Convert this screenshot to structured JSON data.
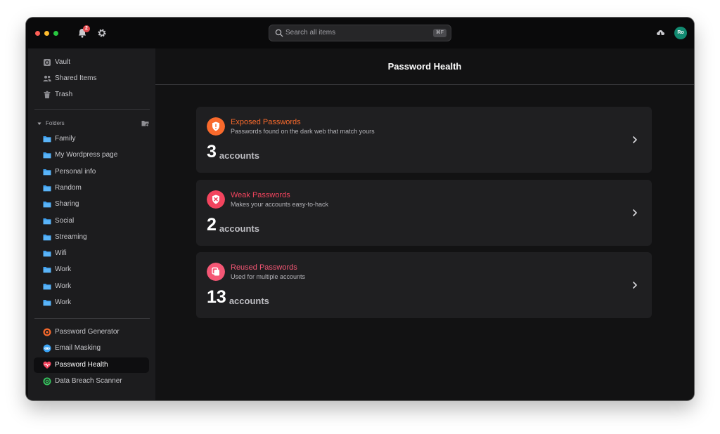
{
  "titlebar": {
    "notification_count": "2",
    "search": {
      "placeholder": "Search all items",
      "shortcut": "⌘F"
    },
    "avatar_initials": "Ro"
  },
  "sidebar": {
    "top_items": [
      {
        "label": "Vault",
        "icon": "vault-icon"
      },
      {
        "label": "Shared Items",
        "icon": "users-icon"
      },
      {
        "label": "Trash",
        "icon": "trash-icon"
      }
    ],
    "folders_label": "Folders",
    "folders": [
      "Family",
      "My Wordpress page",
      "Personal info",
      "Random",
      "Sharing",
      "Social",
      "Streaming",
      "Wifi",
      "Work",
      "Work",
      "Work"
    ],
    "tools": [
      {
        "label": "Password Generator",
        "icon": "password-generator-icon",
        "active": false
      },
      {
        "label": "Email Masking",
        "icon": "email-masking-icon",
        "active": false
      },
      {
        "label": "Password Health",
        "icon": "heart-pulse-icon",
        "active": true
      },
      {
        "label": "Data Breach Scanner",
        "icon": "breach-scanner-icon",
        "active": false
      }
    ]
  },
  "main": {
    "title": "Password Health",
    "cards": [
      {
        "title": "Exposed Passwords",
        "subtitle": "Passwords found on the dark web that match yours",
        "count": "3",
        "unit": "accounts",
        "color": "#f96a2c",
        "icon": "shield-alert-icon"
      },
      {
        "title": "Weak Passwords",
        "subtitle": "Makes your accounts easy-to-hack",
        "count": "2",
        "unit": "accounts",
        "color": "#f3445e",
        "icon": "shield-x-icon"
      },
      {
        "title": "Reused Passwords",
        "subtitle": "Used for multiple accounts",
        "count": "13",
        "unit": "accounts",
        "color": "#f55775",
        "icon": "copy-icon"
      }
    ]
  }
}
